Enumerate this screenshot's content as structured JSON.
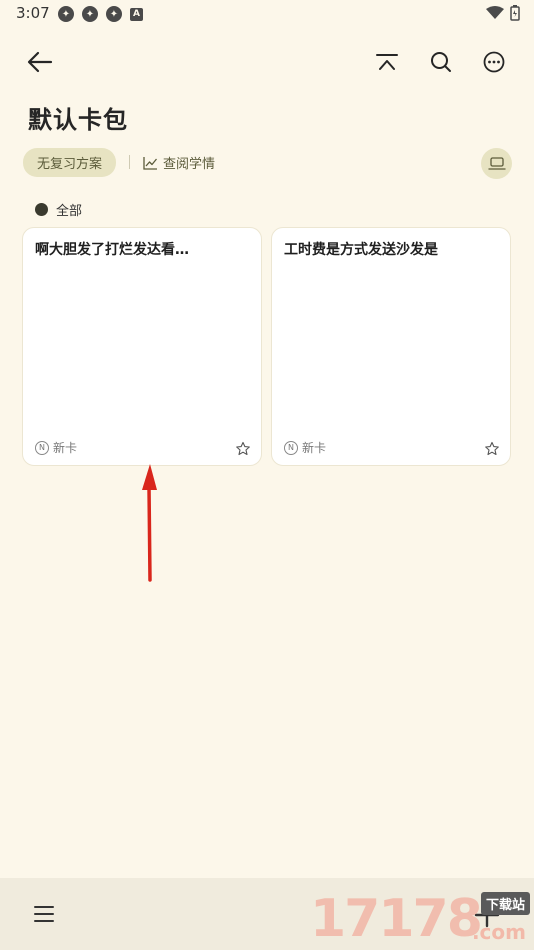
{
  "status_bar": {
    "time": "3:07"
  },
  "header": {
    "title": "默认卡包"
  },
  "toolbar": {
    "plan_label": "无复习方案",
    "stats_label": "查阅学情"
  },
  "filter": {
    "label": "全部"
  },
  "cards": [
    {
      "title": "啊大胆发了打烂发达看…",
      "badge": "新卡"
    },
    {
      "title": "工时费是方式发送沙发是",
      "badge": "新卡"
    }
  ],
  "watermark": {
    "number": "17178",
    "tag": "下载站",
    "suffix": ".com"
  },
  "colors": {
    "background": "#fcf7ea",
    "chip": "#e7e3c2",
    "bottom_bar": "#f0ebdd",
    "annotation_arrow": "#d9261c"
  }
}
